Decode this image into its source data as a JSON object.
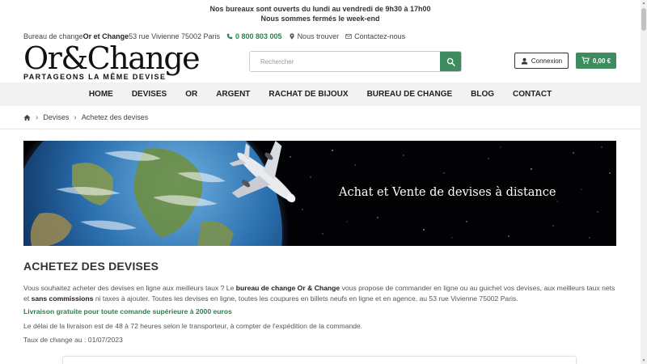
{
  "announcement": {
    "line1": "Nos bureaux sont ouverts du lundi au vendredi de 9h30 à 17h00",
    "line2": "Nous sommes fermés le week-end"
  },
  "info_bar": {
    "address_prefix": "Bureau de change ",
    "brand": "Or et Change",
    "address": " 53 rue Vivienne 75002 Paris",
    "phone": "0 800 803 005",
    "find_us": "Nous trouver",
    "contact": "Contactez-nous"
  },
  "logo": {
    "name": "Or&Change",
    "tagline": "PARTAGEONS LA MÊME DEVISE"
  },
  "search": {
    "placeholder": "Rechercher"
  },
  "account": {
    "login_label": "Connexion",
    "cart_label": "0,00 €"
  },
  "nav": [
    {
      "label": "HOME"
    },
    {
      "label": "DEVISES"
    },
    {
      "label": "OR"
    },
    {
      "label": "ARGENT"
    },
    {
      "label": "RACHAT DE BIJOUX"
    },
    {
      "label": "BUREAU DE CHANGE"
    },
    {
      "label": "BLOG"
    },
    {
      "label": "CONTACT"
    }
  ],
  "breadcrumb": {
    "items": [
      "Devises",
      "Achetez des devises"
    ]
  },
  "banner": {
    "text": "Achat et Vente de devises à distance"
  },
  "main": {
    "title": "ACHETEZ DES DEVISES",
    "p1_a": "Vous souhaitez acheter des devises en ligne aux meilleurs taux ? Le ",
    "p1_b": "bureau de change Or & Change",
    "p1_c": " vous propose de commander en ligne ou au guichet vos devises, aux meilleurs taux nets et ",
    "p1_d": "sans commissions",
    "p1_e": " ni taxes à ajouter. Toutes les devises en ligne, toutes les coupures en billets neufs en ligne et en agence, au 53 rue Vivienne 75002 Paris.",
    "free_delivery": "Livraison gratuite pour toute comande supérieure à 2000 euros",
    "delivery_delay": "Le délai de la livraison est de 48 à 72 heures selon le transporteur, à compter de l'expédition de la commande.",
    "rate_date": "Taux de change au : 01/07/2023"
  },
  "colors": {
    "accent": "#3d8b5e",
    "accent_text": "#2e7d4f",
    "nav_bg": "#f2f2f2"
  }
}
